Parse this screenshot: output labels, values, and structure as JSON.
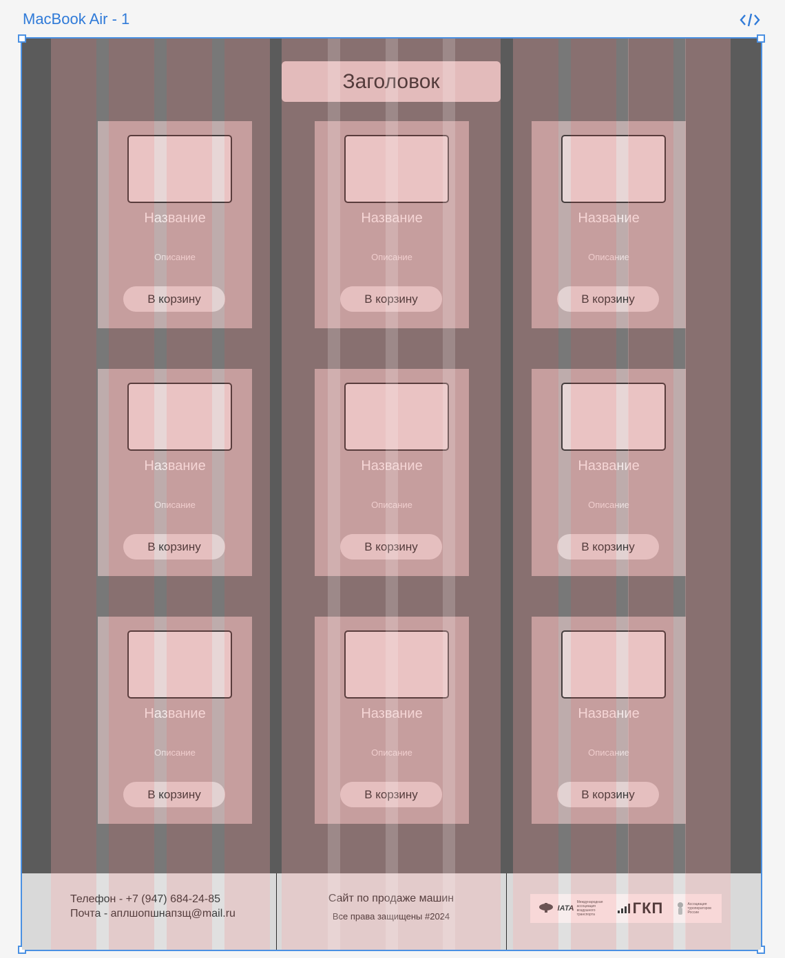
{
  "frame": {
    "label": "MacBook Air - 1"
  },
  "icons": {
    "code": "code-brackets-icon"
  },
  "page": {
    "title": "Заголовок",
    "cards": [
      {
        "title": "Название",
        "description": "Описание",
        "button": "В корзину"
      },
      {
        "title": "Название",
        "description": "Описание",
        "button": "В корзину"
      },
      {
        "title": "Название",
        "description": "Описание",
        "button": "В корзину"
      },
      {
        "title": "Название",
        "description": "Описание",
        "button": "В корзину"
      },
      {
        "title": "Название",
        "description": "Описание",
        "button": "В корзину"
      },
      {
        "title": "Название",
        "description": "Описание",
        "button": "В корзину"
      },
      {
        "title": "Название",
        "description": "Описание",
        "button": "В корзину"
      },
      {
        "title": "Название",
        "description": "Описание",
        "button": "В корзину"
      },
      {
        "title": "Название",
        "description": "Описание",
        "button": "В корзину"
      }
    ]
  },
  "footer": {
    "phone": "Телефон - +7 (947) 684-24-85",
    "email": "Почта - аплшопшнапзщ@mail.ru",
    "site_name": "Сайт по продаже машин",
    "copyright": "Все права защищены #2024",
    "logos": {
      "iata_mark": "IATA",
      "iata_text": "Международная ассоциация воздушного транспорта",
      "gkp": "ГКП",
      "ator_text": "Ассоциация туроператоров России"
    }
  },
  "colors": {
    "frame_accent": "#4a90e2",
    "page_bg": "#5b5b5b",
    "card_bg": "#b09a9a",
    "header_bg": "#d9c3c3",
    "footer_bg": "#d9d9d9"
  }
}
